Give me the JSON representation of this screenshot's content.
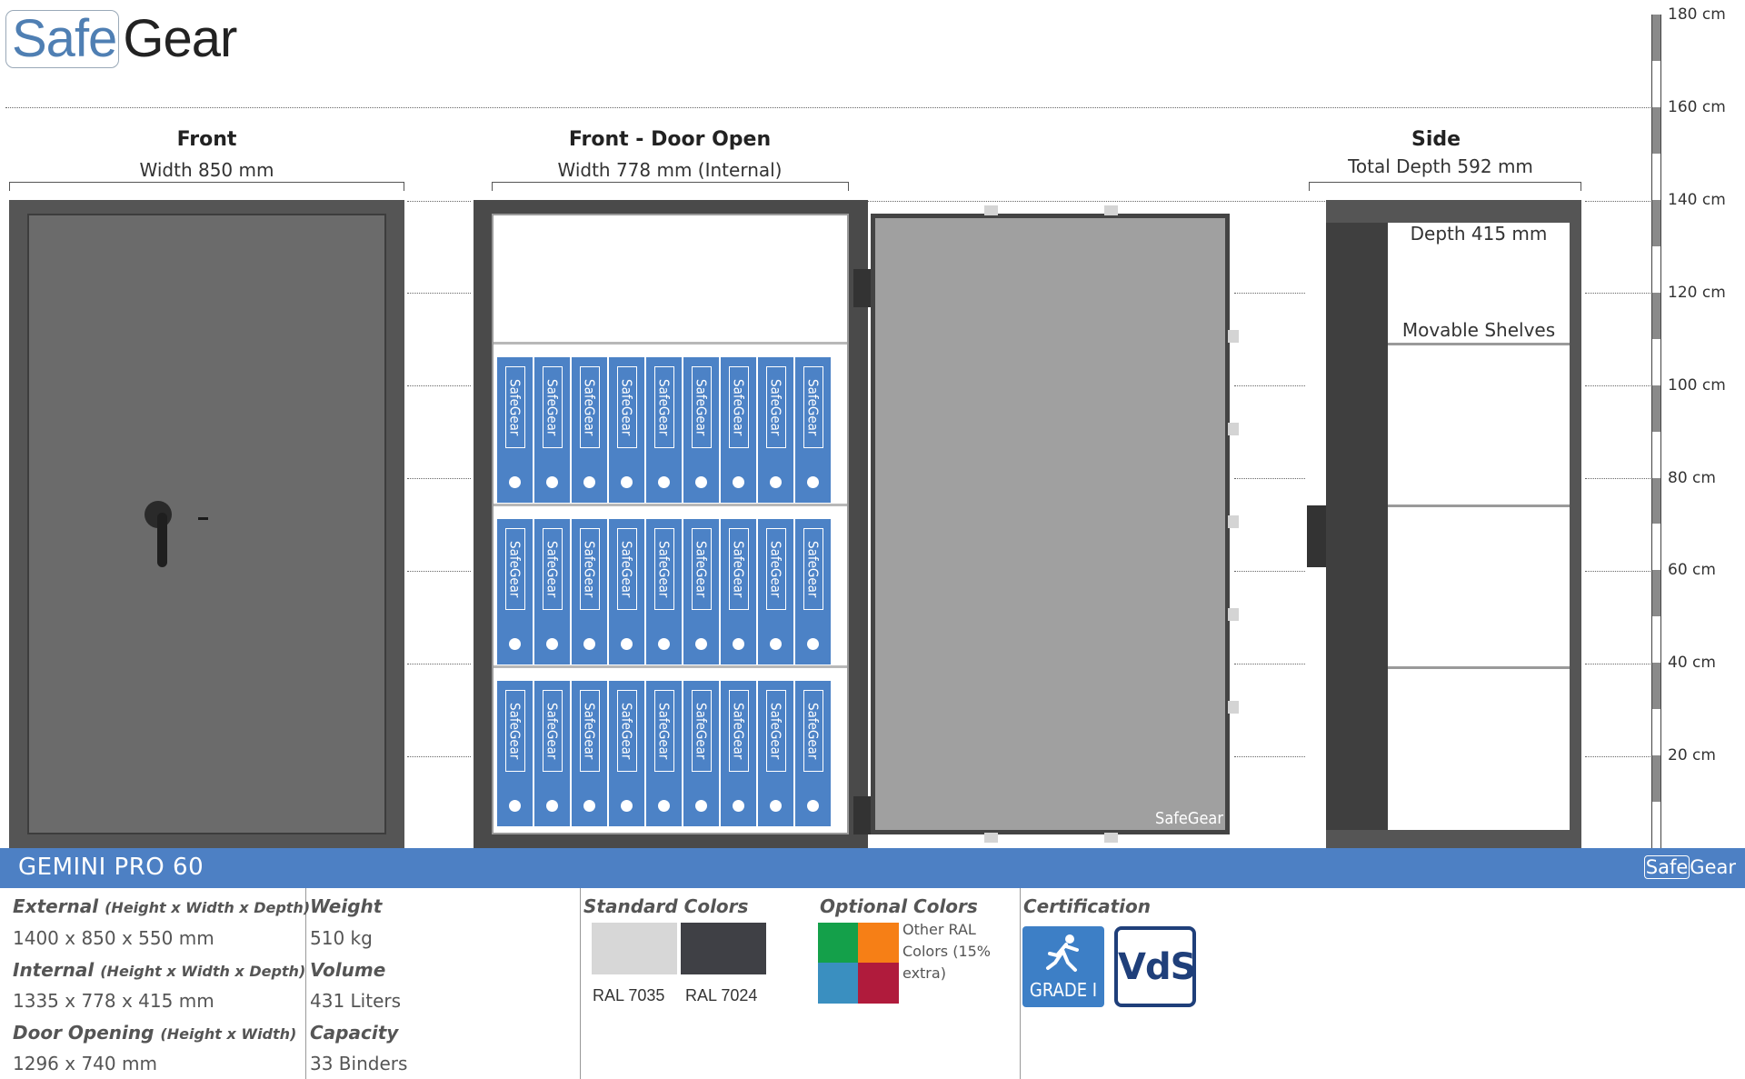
{
  "brand": {
    "safe": "Safe",
    "gear": "Gear"
  },
  "views": {
    "front": {
      "title": "Front",
      "subtitle": "Width 850 mm"
    },
    "open": {
      "title": "Front - Door Open",
      "subtitle": "Width 778 mm (Internal)"
    },
    "side": {
      "title": "Side",
      "subtitle": "Total Depth 592 mm",
      "depth_label": "Depth 415 mm",
      "shelves_label": "Movable Shelves"
    }
  },
  "binder_label": "SafeGear",
  "door_logo": "SafeGear",
  "ruler": [
    "180 cm",
    "160 cm",
    "140 cm",
    "120 cm",
    "100 cm",
    "80 cm",
    "60 cm",
    "40 cm",
    "20 cm"
  ],
  "banner": {
    "model": "GEMINI PRO 60",
    "logo_safe": "Safe",
    "logo_gear": "Gear"
  },
  "specs": {
    "external_label": "External",
    "external_note": "(Height x Width x Depth)",
    "external_value": "1400 x 850 x 550 mm",
    "internal_label": "Internal",
    "internal_note": "(Height x Width x Depth)",
    "internal_value": "1335 x 778 x 415 mm",
    "door_label": "Door Opening",
    "door_note": "(Height x Width)",
    "door_value": "1296 x 740 mm",
    "weight_label": "Weight",
    "weight_value": "510 kg",
    "volume_label": "Volume",
    "volume_value": "431 Liters",
    "capacity_label": "Capacity",
    "capacity_value": "33 Binders"
  },
  "colors": {
    "standard_title": "Standard Colors",
    "standard": [
      {
        "name": "RAL 7035",
        "hex": "#d7d7d7"
      },
      {
        "name": "RAL 7024",
        "hex": "#3f4045"
      }
    ],
    "optional_title": "Optional Colors",
    "optional_text": "Other RAL Colors (15% extra)",
    "optional_swatches": [
      "#14a04a",
      "#f67f16",
      "#3a8fc0",
      "#b01b3c"
    ]
  },
  "certification": {
    "title": "Certification",
    "grade": "GRADE I",
    "vds": "VdS"
  }
}
